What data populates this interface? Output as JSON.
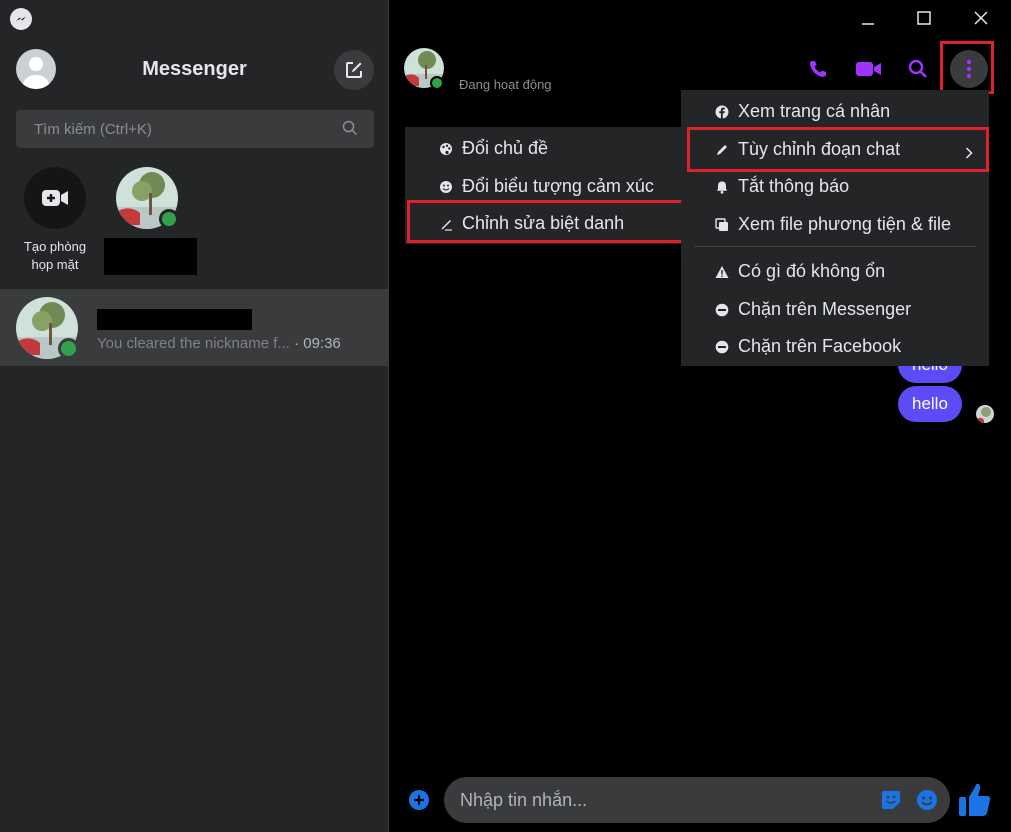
{
  "sidebar": {
    "title": "Messenger",
    "search_placeholder": "Tìm kiếm (Ctrl+K)",
    "create_room_line1": "Tạo phòng",
    "create_room_line2": "họp mặt",
    "conversation": {
      "preview": "You cleared the nickname f...",
      "time": " · 09:36"
    }
  },
  "chat": {
    "status": "Đang hoạt động",
    "bubble_top": "hello",
    "bubble_bottom": "hello",
    "composer_placeholder": "Nhập tin nhắn..."
  },
  "more_menu": {
    "items": [
      {
        "label": "Xem trang cá nhân",
        "icon": "facebook-icon"
      },
      {
        "label": "Tùy chỉnh đoạn chat",
        "icon": "pencil-icon"
      },
      {
        "label": "Tắt thông báo",
        "icon": "bell-icon"
      },
      {
        "label": "Xem file phương tiện & file",
        "icon": "media-icon"
      },
      {
        "label": "Có gì đó không ổn",
        "icon": "warning-icon"
      },
      {
        "label": "Chặn trên Messenger",
        "icon": "block-icon"
      },
      {
        "label": "Chặn trên Facebook",
        "icon": "block-icon"
      }
    ]
  },
  "sub_menu": {
    "items": [
      {
        "label": "Đổi chủ đề",
        "icon": "palette-icon"
      },
      {
        "label": "Đổi biểu tượng cảm xúc",
        "icon": "emoji-icon"
      },
      {
        "label": "Chỉnh sửa biệt danh",
        "icon": "edit-name-icon"
      }
    ]
  },
  "colors": {
    "accent": "#a033ff",
    "bubble": "#5b4cf7",
    "online": "#31a24c",
    "highlight": "#e0202a",
    "composer_icon": "#1b74e4"
  }
}
